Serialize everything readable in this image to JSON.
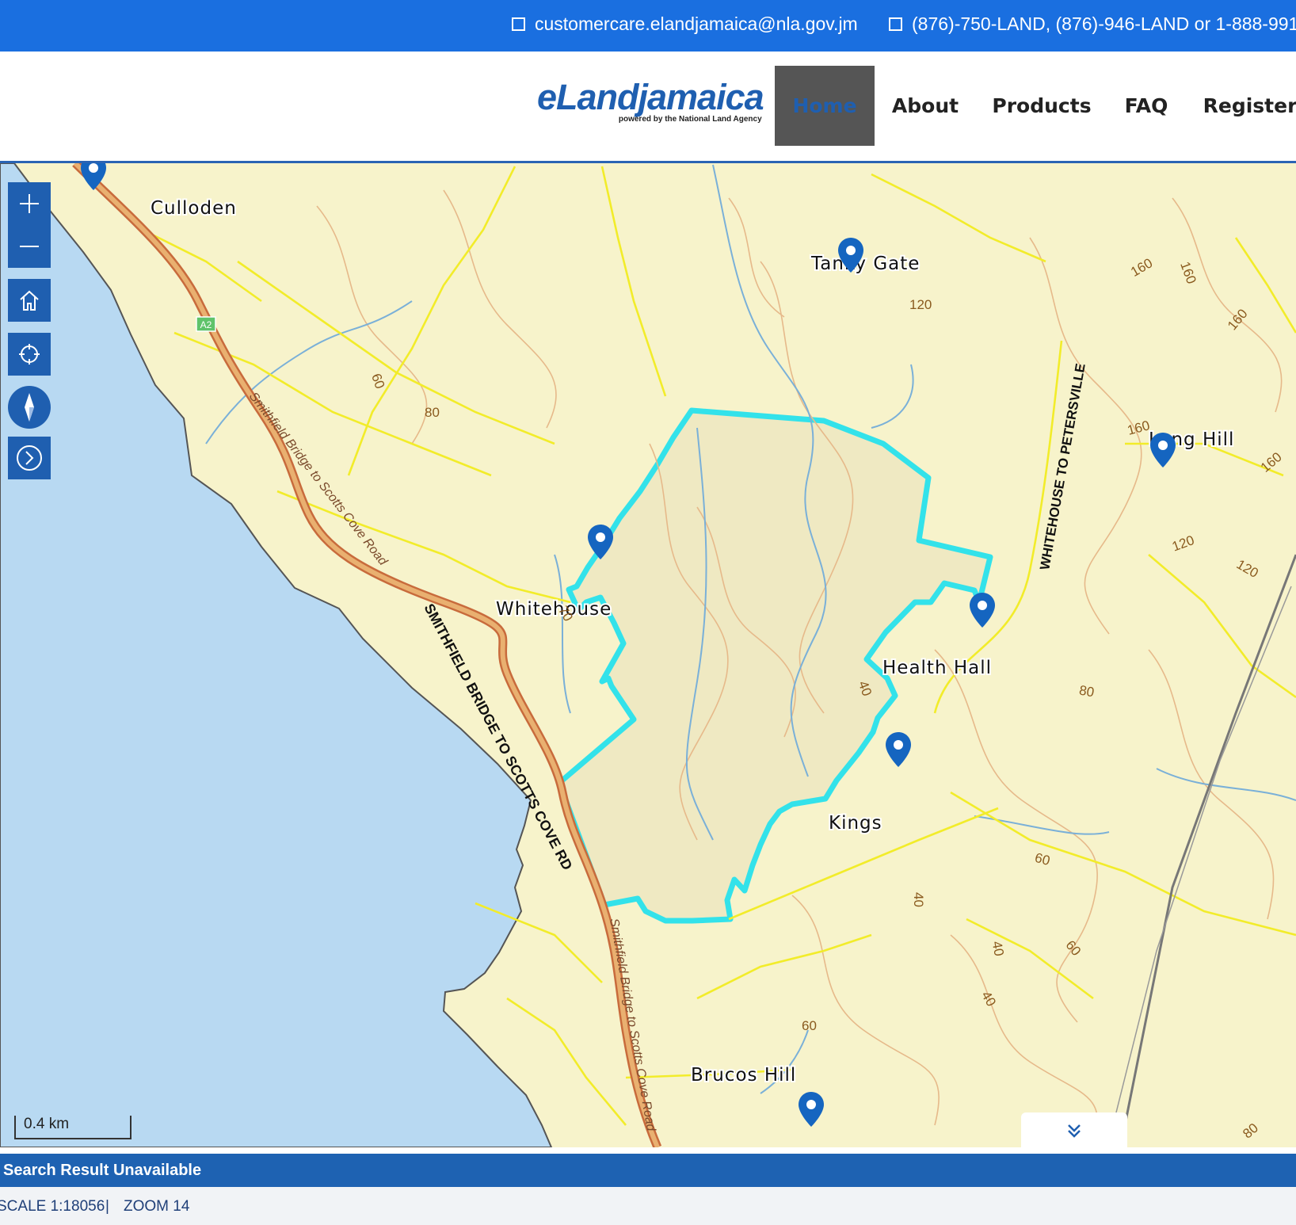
{
  "contact": {
    "email": "customercare.elandjamaica@nla.gov.jm",
    "phone": "(876)-750-LAND, (876)-946-LAND or 1-888-991"
  },
  "logo": {
    "main": "eLandjamaica",
    "sub": "powered by the National Land Agency"
  },
  "nav": [
    "Home",
    "About",
    "Products",
    "FAQ",
    "Register"
  ],
  "nav_active": "Home",
  "map_controls": [
    "zoom-in-icon",
    "zoom-out-icon",
    "home-icon",
    "locate-icon",
    "compass-icon",
    "next-arrow-icon"
  ],
  "places": [
    "Culloden",
    "Tanky Gate",
    "Long Hill",
    "Whitehouse",
    "Health Hall",
    "Kings",
    "Brucos Hill"
  ],
  "road_labels": {
    "main": "SMITHFIELD BRIDGE TO SCOTTS COVE  RD",
    "secondary": "WHITEHOUSE TO PETERSVILLE",
    "italic_north": "Smithfield Bridge to Scotts Cove Road",
    "italic_south": "Smithfield Bridge to Scotts Cove Road",
    "shield": "A2"
  },
  "contour_labels": [
    "120",
    "160",
    "160",
    "160",
    "160",
    "160",
    "60",
    "80",
    "120",
    "120",
    "80",
    "60",
    "60",
    "60",
    "80",
    "40",
    "40",
    "40",
    "40",
    "70"
  ],
  "scale_bar": {
    "label": "0.4 km"
  },
  "result_status": "Search Result Unavailable",
  "status": {
    "scale": "SCALE 1:18056",
    "separator": "|",
    "zoom": "ZOOM 14"
  },
  "colors": {
    "topbar": "#1a6fe0",
    "brand": "#1f5fb0",
    "land": "#f7f3cb",
    "water": "#b8d9f2",
    "parcel_outline": "#33e2ea",
    "roads": "#f2ec2a",
    "main_road": "#d88a55",
    "streams": "#7ab0d8",
    "contours": "#e6b98a",
    "marker": "#1565c0"
  }
}
